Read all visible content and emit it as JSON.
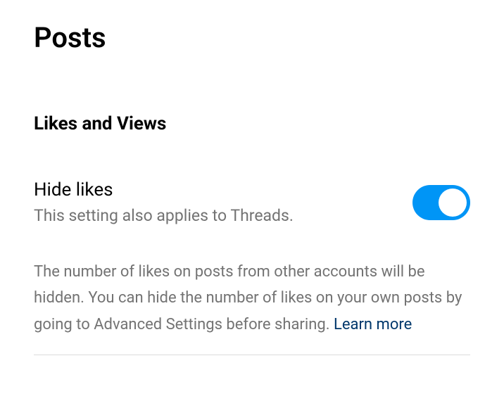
{
  "page": {
    "title": "Posts"
  },
  "section": {
    "title": "Likes and Views"
  },
  "setting": {
    "label": "Hide likes",
    "subtitle": "This setting also applies to Threads.",
    "enabled": true
  },
  "description": {
    "text": "The number of likes on posts from other accounts will be hidden. You can hide the number of likes on your own posts by going to Advanced Settings before sharing. ",
    "link_text": "Learn more"
  }
}
